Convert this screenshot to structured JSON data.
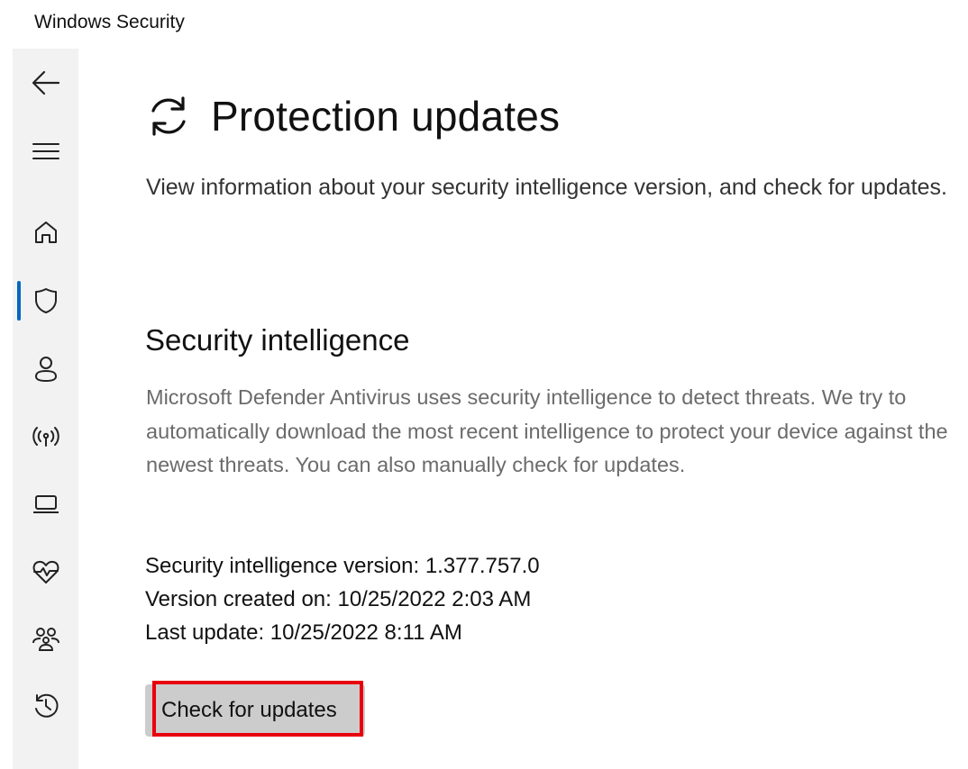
{
  "window": {
    "title": "Windows Security"
  },
  "sidebar": {
    "items": [
      {
        "icon": "back-arrow-icon"
      },
      {
        "icon": "hamburger-menu-icon"
      },
      {
        "icon": "home-icon"
      },
      {
        "icon": "shield-icon",
        "active": true
      },
      {
        "icon": "account-icon"
      },
      {
        "icon": "wireless-icon"
      },
      {
        "icon": "laptop-icon"
      },
      {
        "icon": "heart-pulse-icon"
      },
      {
        "icon": "family-icon"
      },
      {
        "icon": "history-icon"
      }
    ],
    "accent_color": "#0067c0"
  },
  "main": {
    "title": "Protection updates",
    "title_icon": "refresh-icon",
    "description": "View information about your security intelligence version, and check for updates.",
    "section": {
      "heading": "Security intelligence",
      "description": "Microsoft Defender Antivirus uses security intelligence to detect threats. We try to automatically download the most recent intelligence to protect your device against the newest threats. You can also manually check for updates.",
      "version_line": "Security intelligence version: 1.377.757.0",
      "created_line": "Version created on: 10/25/2022 2:03 AM",
      "last_update_line": "Last update: 10/25/2022 8:11 AM",
      "button_label": "Check for updates"
    }
  },
  "highlight_color": "#e8000d"
}
